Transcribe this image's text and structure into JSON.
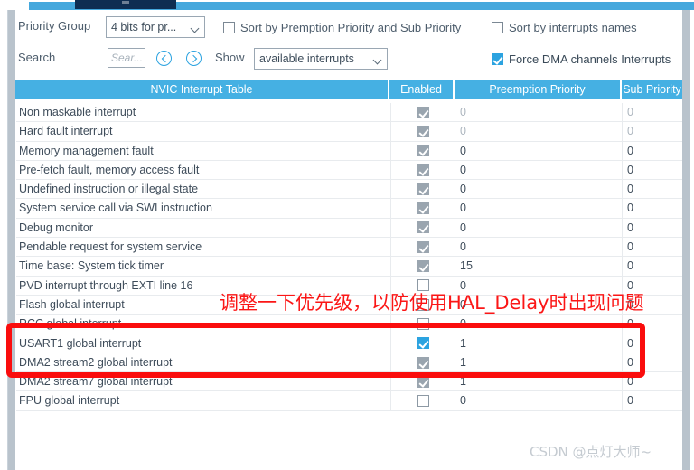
{
  "colors": {
    "accent_blue": "#45b0e3",
    "control_blue": "#2ca3e0",
    "annotation_red": "#fa0d0d",
    "tab_active_navy": "#0e2d52",
    "watermark_grey": "#c5cbd1"
  },
  "toolbar": {
    "priority_group_label": "Priority Group",
    "priority_group_value": "4 bits for pr...",
    "sort_by_preemption_label": "Sort by Premption Priority and Sub Priority",
    "sort_by_preemption_checked": false,
    "sort_by_names_label": "Sort by interrupts names",
    "sort_by_names_checked": false,
    "search_label": "Search",
    "search_value": "",
    "search_placeholder": "Sear...",
    "prev_icon": "chevron-left-circle-icon",
    "next_icon": "chevron-right-circle-icon",
    "show_label": "Show",
    "show_value": "available interrupts",
    "force_dma_label": "Force DMA channels Interrupts",
    "force_dma_checked": true
  },
  "table": {
    "columns": [
      "NVIC Interrupt Table",
      "Enabled",
      "Preemption Priority",
      "Sub Priority"
    ],
    "rows": [
      {
        "name": "Non maskable interrupt",
        "enabled": "grey",
        "preemption": "0",
        "sub": "0",
        "dim": true
      },
      {
        "name": "Hard fault interrupt",
        "enabled": "grey",
        "preemption": "0",
        "sub": "0",
        "dim": true
      },
      {
        "name": "Memory management fault",
        "enabled": "grey",
        "preemption": "0",
        "sub": "0",
        "dim": false
      },
      {
        "name": "Pre-fetch fault, memory access fault",
        "enabled": "grey",
        "preemption": "0",
        "sub": "0",
        "dim": false
      },
      {
        "name": "Undefined instruction or illegal state",
        "enabled": "grey",
        "preemption": "0",
        "sub": "0",
        "dim": false
      },
      {
        "name": "System service call via SWI instruction",
        "enabled": "grey",
        "preemption": "0",
        "sub": "0",
        "dim": false
      },
      {
        "name": "Debug monitor",
        "enabled": "grey",
        "preemption": "0",
        "sub": "0",
        "dim": false
      },
      {
        "name": "Pendable request for system service",
        "enabled": "grey",
        "preemption": "0",
        "sub": "0",
        "dim": false
      },
      {
        "name": "Time base: System tick timer",
        "enabled": "grey",
        "preemption": "15",
        "sub": "0",
        "dim": false
      },
      {
        "name": "PVD interrupt through EXTI line 16",
        "enabled": "unchecked",
        "preemption": "0",
        "sub": "0",
        "dim": false
      },
      {
        "name": "Flash global interrupt",
        "enabled": "unchecked",
        "preemption": "0",
        "sub": "0",
        "dim": false
      },
      {
        "name": "RCC global interrupt",
        "enabled": "unchecked",
        "preemption": "0",
        "sub": "0",
        "dim": false
      },
      {
        "name": "USART1 global interrupt",
        "enabled": "blue",
        "preemption": "1",
        "sub": "0",
        "dim": false
      },
      {
        "name": "DMA2 stream2 global interrupt",
        "enabled": "grey",
        "preemption": "1",
        "sub": "0",
        "dim": false
      },
      {
        "name": "DMA2 stream7 global interrupt",
        "enabled": "grey",
        "preemption": "1",
        "sub": "0",
        "dim": false
      },
      {
        "name": "FPU global interrupt",
        "enabled": "unchecked",
        "preemption": "0",
        "sub": "0",
        "dim": false
      }
    ]
  },
  "annotations": {
    "note_text": "调整一下优先级，以防使用HAL_Delay时出现问题",
    "highlight_box": "red-rounded-rectangle"
  },
  "watermark": {
    "text": "CSDN @点灯大师~"
  }
}
